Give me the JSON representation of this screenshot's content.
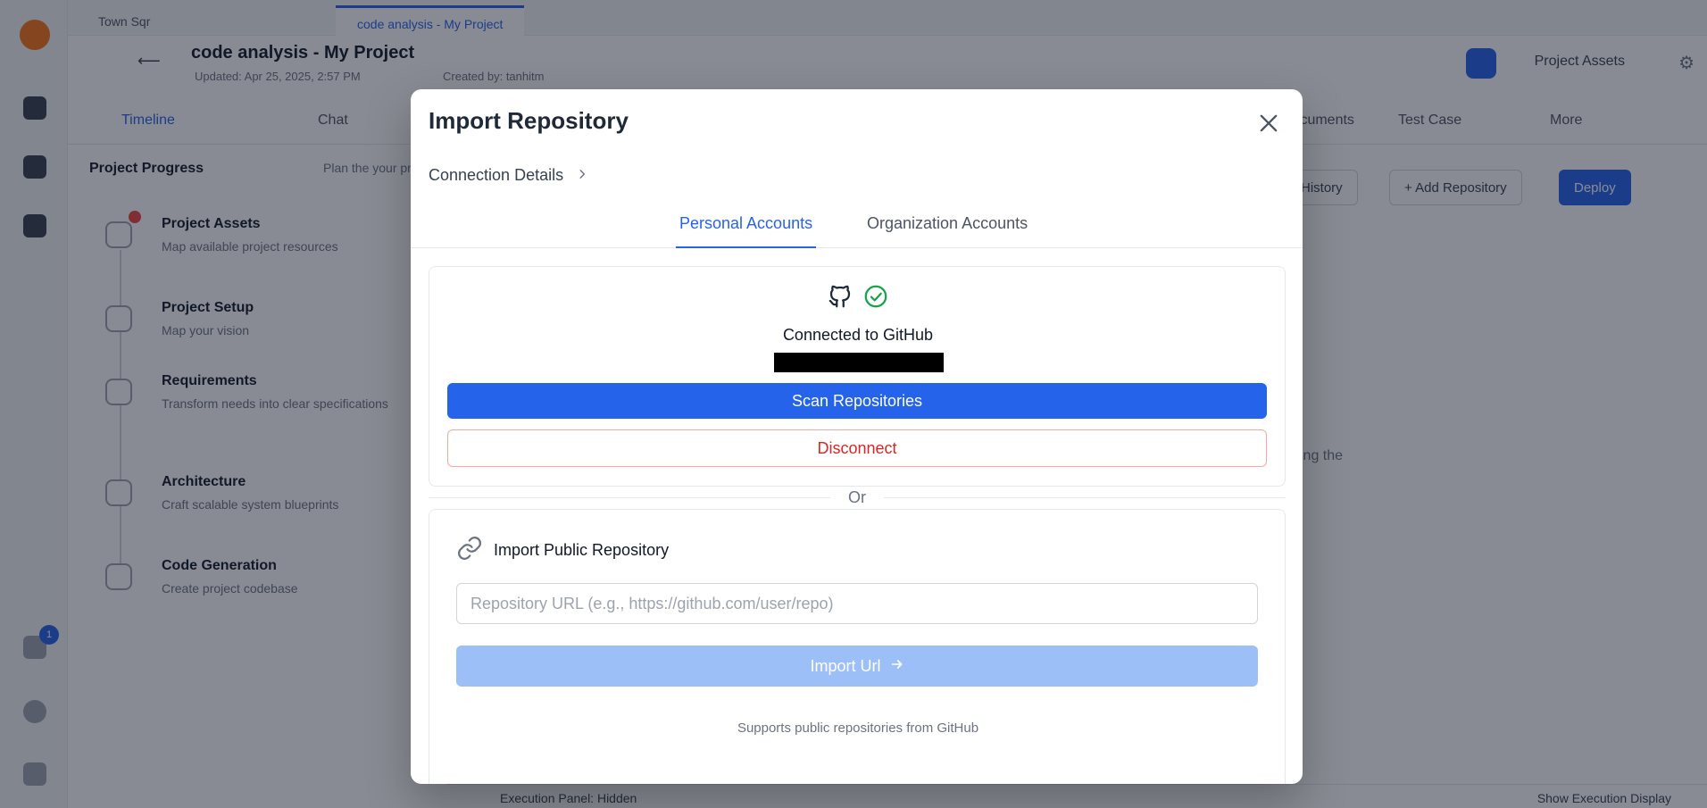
{
  "background": {
    "tabs": [
      "Town Sqr",
      "code analysis - My Project"
    ],
    "project": {
      "title": "code analysis - My Project",
      "updated": "Updated: Apr 25, 2025, 2:57 PM",
      "created_by": "Created by: tanhitm"
    },
    "header": {
      "assets_label": "Project Assets"
    },
    "subtabs": [
      "Timeline",
      "Chat",
      "Documents",
      "Test Case",
      "More"
    ],
    "progress": {
      "title": "Project Progress",
      "hint": "Plan the your process"
    },
    "steps": [
      {
        "name": "Project Assets",
        "desc": "Map available project resources"
      },
      {
        "name": "Project Setup",
        "desc": "Map your vision"
      },
      {
        "name": "Requirements",
        "desc": "Transform needs into clear specifications"
      },
      {
        "name": "Architecture",
        "desc": "Craft scalable system blueprints"
      },
      {
        "name": "Code Generation",
        "desc": "Create project codebase"
      }
    ],
    "actions": [
      "History",
      "+ Add Repository",
      "Deploy"
    ],
    "content_hint": "ing the",
    "bottom": {
      "left": "Execution Panel: Hidden",
      "right": "Show Execution Display"
    },
    "notif_count": "1"
  },
  "modal": {
    "title": "Import Repository",
    "breadcrumb": "Connection Details",
    "tabs": [
      {
        "label": "Personal Accounts",
        "active": true
      },
      {
        "label": "Organization Accounts",
        "active": false
      }
    ],
    "github": {
      "status": "Connected to GitHub",
      "scan_label": "Scan Repositories",
      "disconnect_label": "Disconnect"
    },
    "divider_label": "Or",
    "public": {
      "title": "Import Public Repository",
      "url_placeholder": "Repository URL (e.g., https://github.com/user/repo)",
      "url_value": "",
      "import_label": "Import Url",
      "supports_text": "Supports public repositories from GitHub"
    }
  },
  "colors": {
    "accent": "#2563eb",
    "danger": "#dc2626",
    "success": "#16a34a",
    "import_disabled": "#9dbff8"
  },
  "icons": [
    "close-icon",
    "chevron-right-icon",
    "github-icon",
    "check-circle-icon",
    "link-icon",
    "arrow-right-icon"
  ]
}
